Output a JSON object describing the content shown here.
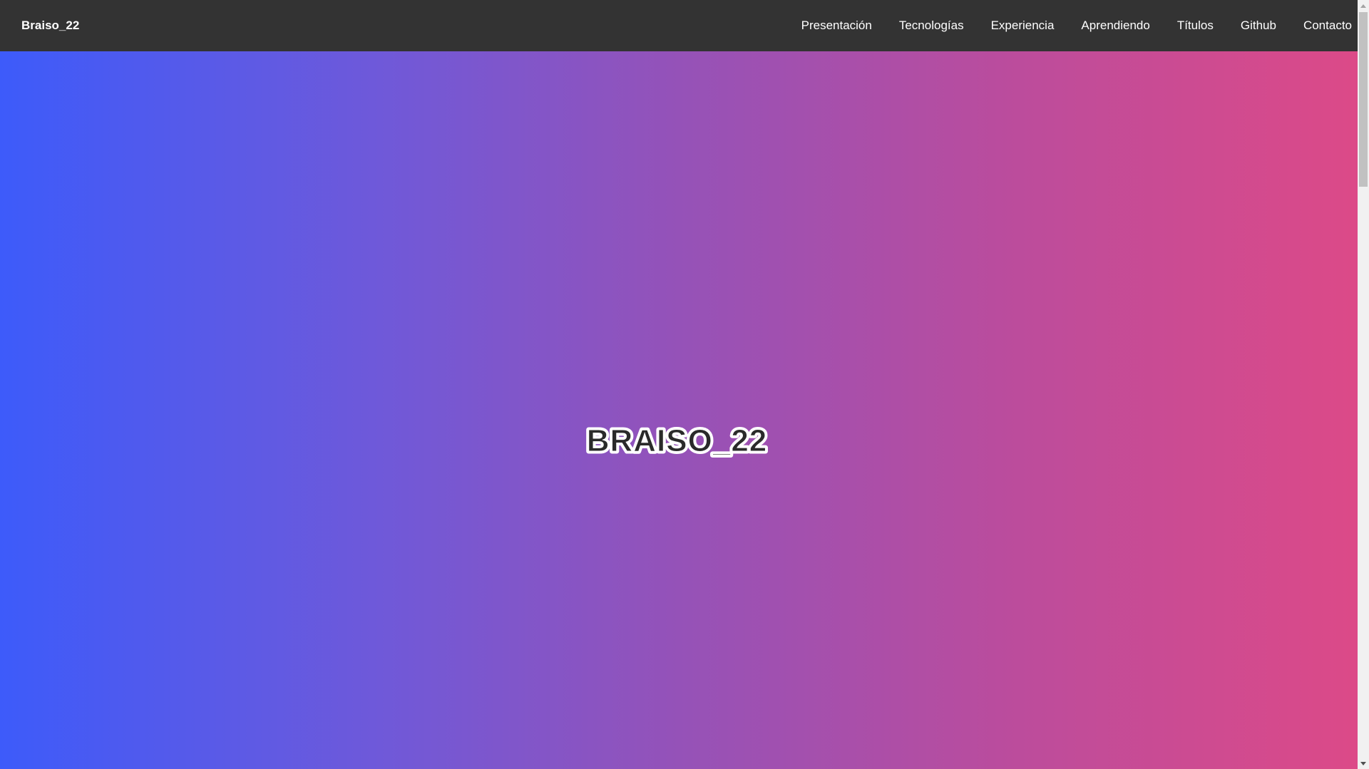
{
  "navbar": {
    "brand": "Braiso_22",
    "links": [
      {
        "label": "Presentación"
      },
      {
        "label": "Tecnologías"
      },
      {
        "label": "Experiencia"
      },
      {
        "label": "Aprendiendo"
      },
      {
        "label": "Títulos"
      },
      {
        "label": "Github"
      },
      {
        "label": "Contacto"
      }
    ]
  },
  "hero": {
    "logo_text": "BRAISO_22"
  },
  "colors": {
    "navbar_bg": "#333333",
    "gradient_start": "#3d5bfa",
    "gradient_end": "#dc4a88"
  },
  "scrollbar": {
    "icons": [
      "chevron-up-icon",
      "chevron-down-icon"
    ]
  }
}
